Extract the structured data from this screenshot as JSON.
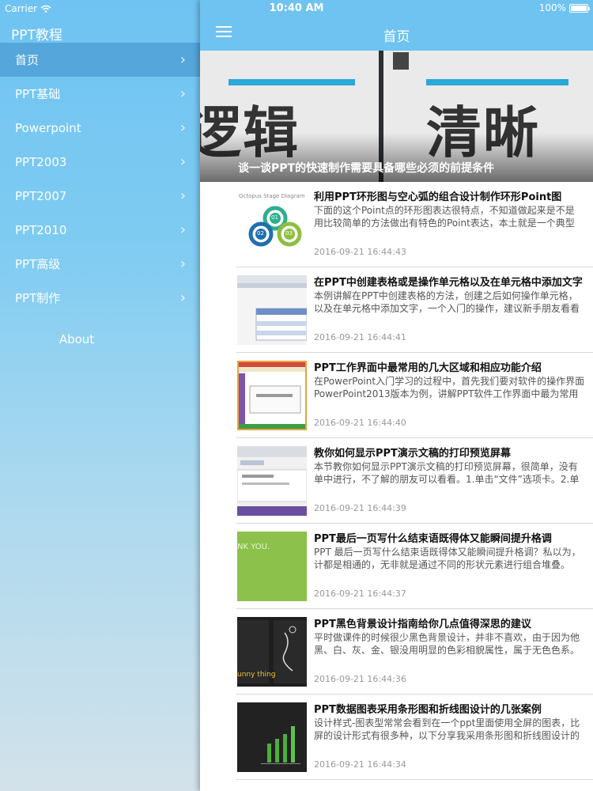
{
  "status": {
    "carrier": "Carrier",
    "time": "10:40 AM",
    "battery": "100%"
  },
  "sidebar": {
    "title": "PPT教程",
    "items": [
      {
        "label": "首页",
        "active": true
      },
      {
        "label": "PPT基础"
      },
      {
        "label": "Powerpoint"
      },
      {
        "label": "PPT2003"
      },
      {
        "label": "PPT2007"
      },
      {
        "label": "PPT2010"
      },
      {
        "label": "PPT高级"
      },
      {
        "label": "PPT制作"
      }
    ],
    "about": "About"
  },
  "header": {
    "title": "首页"
  },
  "hero": {
    "left_text": "逻辑",
    "right_text": "清晰",
    "caption": "谈一谈PPT的快速制作需要具备哪些必须的前提条件"
  },
  "articles": [
    {
      "title": "利用PPT环形图与空心弧的组合设计制作环形Point图",
      "desc1": "下面的这个Point点的环形图表达很特点，不知道做起来是不是",
      "desc2": "用比较简单的方法做出有特色的Point表达，本土就是一个典型",
      "date": "2016-09-21 16:44:43",
      "thumb_text": "Octopus Stage Diagram",
      "thumb_nums": [
        "01",
        "02",
        "03"
      ]
    },
    {
      "title": "在PPT中创建表格或是操作单元格以及在单元格中添加文字",
      "desc1": "本例讲解在PPT中创建表格的方法，创建之后如何操作单元格，",
      "desc2": "以及在单元格中添加文字，一个入门的操作，建议新手朋友看看",
      "date": "2016-09-21 16:44:41"
    },
    {
      "title": "PPT工作界面中最常用的几大区域和相应功能介绍",
      "desc1": "在PowerPoint入门学习的过程中，首先我们要对软件的操作界面",
      "desc2": "PowerPoint2013版本为例，讲解PPT软件工作界面中最为常用",
      "date": "2016-09-21 16:44:40"
    },
    {
      "title": "教你如何显示PPT演示文稿的打印预览屏幕",
      "desc1": "本节教你如何显示PPT演示文稿的打印预览屏幕，很简单，没有",
      "desc2": "单中进行，不了解的朋友可以看看。1.单击“文件”选项卡。2.单",
      "date": "2016-09-21 16:44:39"
    },
    {
      "title": "PPT最后一页写什么结束语既得体又能瞬间提升格调",
      "desc1": "PPT 最后一页写什么结束语既得体又能瞬间提升格调？私以为，",
      "desc2": "计都是相通的，无非就是通过不同的形状元素进行组合堆叠。",
      "date": "2016-09-21 16:44:37",
      "thumb_text": "NK YOU."
    },
    {
      "title": "PPT黑色背景设计指南给你几点值得深思的建议",
      "desc1": "平时做课件的时候很少黑色背景设计，并非不喜欢，由于因为他",
      "desc2": "黑、白、灰、金、银没用明显的色彩相貌属性，属于无色色系。",
      "date": "2016-09-21 16:44:36",
      "thumb_text": "unny thing"
    },
    {
      "title": "PPT数据图表采用条形图和折线图设计的几张案例",
      "desc1": "设计样式-图表型常常会看到在一个ppt里面使用全屏的图表，比",
      "desc2": "屏的设计形式有很多种，以下分享我采用条形图和折线图设计的",
      "date": "2016-09-21 16:44:34"
    }
  ],
  "colors": {
    "nav": "#6ec3f1",
    "sidebar_top": "#6fc3f2",
    "active_item": "#4a98cf"
  }
}
